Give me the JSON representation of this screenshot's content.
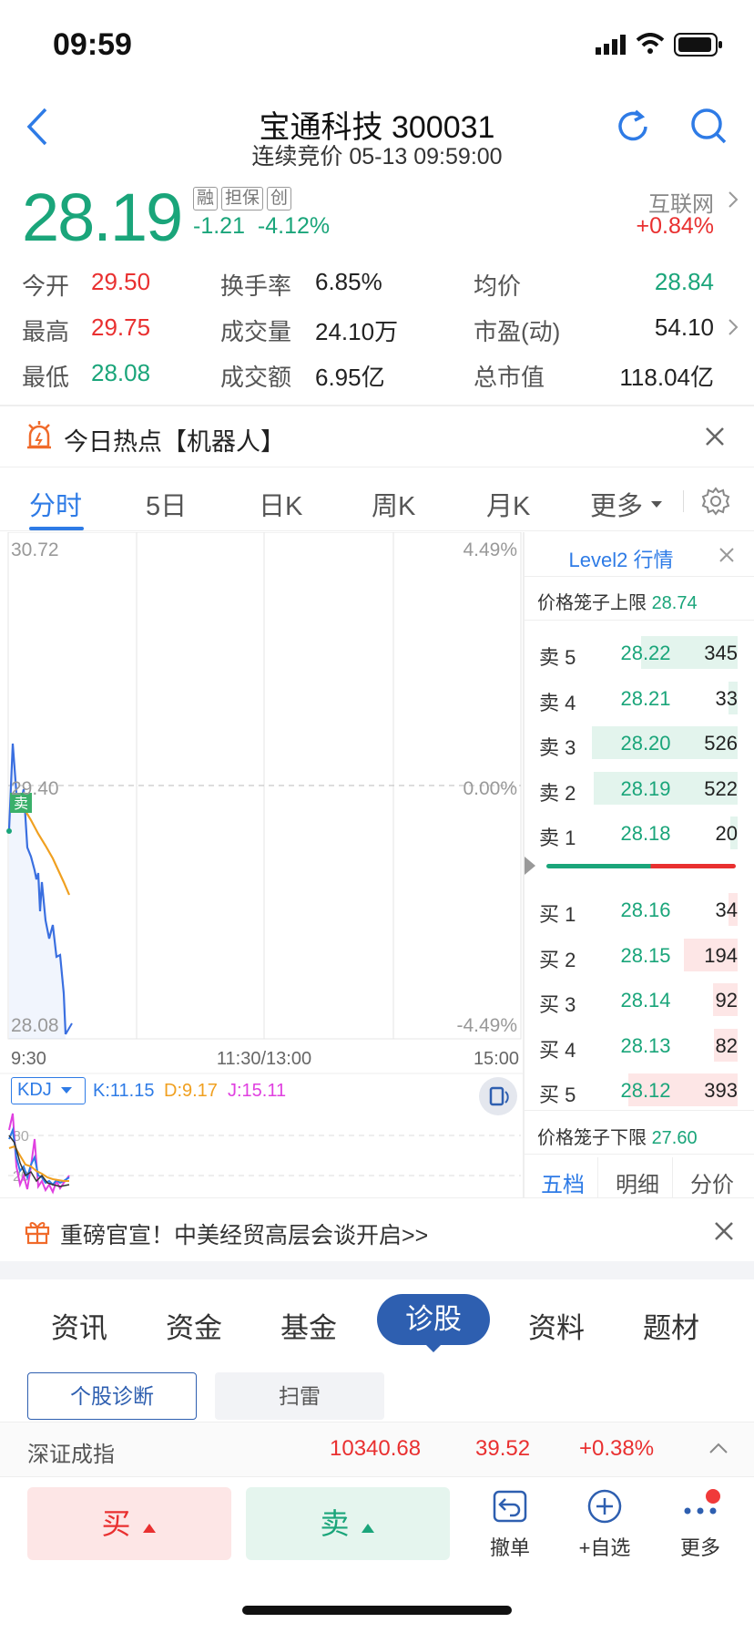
{
  "status_bar": {
    "time": "09:59"
  },
  "header": {
    "title": "宝通科技 300031",
    "subtitle": "连续竞价 05-13 09:59:00"
  },
  "quote": {
    "price": "28.19",
    "tags": [
      "融",
      "担保",
      "创"
    ],
    "change": "-1.21",
    "change_pct": "-4.12%",
    "sector_name": "互联网",
    "sector_change": "+0.84%"
  },
  "stats": [
    {
      "label": "今开",
      "value": "29.50"
    },
    {
      "label": "换手率",
      "value": "6.85%"
    },
    {
      "label": "均价",
      "value": "28.84"
    },
    {
      "label": "最高",
      "value": "29.75"
    },
    {
      "label": "成交量",
      "value": "24.10万"
    },
    {
      "label": "市盈(动)",
      "value": "54.10"
    },
    {
      "label": "最低",
      "value": "28.08"
    },
    {
      "label": "成交额",
      "value": "6.95亿"
    },
    {
      "label": "总市值",
      "value": "118.04亿"
    }
  ],
  "hot_banner": {
    "text": "今日热点【机器人】"
  },
  "chart_tabs": [
    "分时",
    "5日",
    "日K",
    "周K",
    "月K",
    "更多"
  ],
  "chart": {
    "y_top": "30.72",
    "y_mid": "29.40",
    "y_bottom": "28.08",
    "pct_top": "4.49%",
    "pct_mid": "0.00%",
    "pct_bottom": "-4.49%",
    "x_start": "9:30",
    "x_mid": "11:30/13:00",
    "x_end": "15:00",
    "sell_marker": "卖"
  },
  "kdj": {
    "name": "KDJ",
    "k": "K:11.15",
    "d": "D:9.17",
    "j": "J:15.11",
    "level_80": "80",
    "level_20": "20"
  },
  "level2": {
    "title": "Level2 行情",
    "upper_limit_label": "价格笼子上限",
    "upper_limit": "28.74",
    "lower_limit_label": "价格笼子下限",
    "lower_limit": "27.60",
    "asks": [
      {
        "label": "卖 5",
        "price": "28.22",
        "vol": "345",
        "share": 0.66
      },
      {
        "label": "卖 4",
        "price": "28.21",
        "vol": "33",
        "share": 0.06
      },
      {
        "label": "卖 3",
        "price": "28.20",
        "vol": "526",
        "share": 1.0
      },
      {
        "label": "卖 2",
        "price": "28.19",
        "vol": "522",
        "share": 0.99
      },
      {
        "label": "卖 1",
        "price": "28.18",
        "vol": "20",
        "share": 0.04
      }
    ],
    "bids": [
      {
        "label": "买 1",
        "price": "28.16",
        "vol": "34",
        "share": 0.06
      },
      {
        "label": "买 2",
        "price": "28.15",
        "vol": "194",
        "share": 0.37
      },
      {
        "label": "买 3",
        "price": "28.14",
        "vol": "92",
        "share": 0.17
      },
      {
        "label": "买 4",
        "price": "28.13",
        "vol": "82",
        "share": 0.16
      },
      {
        "label": "买 5",
        "price": "28.12",
        "vol": "393",
        "share": 0.75
      }
    ],
    "tabs": [
      "五档",
      "明细",
      "分价"
    ]
  },
  "news_banner": {
    "text": "重磅官宣！中美经贸高层会谈开启>>"
  },
  "section_tabs": [
    "资讯",
    "资金",
    "基金",
    "诊股",
    "资料",
    "题材"
  ],
  "sub_tabs": [
    "个股诊断",
    "扫雷"
  ],
  "index_bar": {
    "name": "深证成指",
    "value": "10340.68",
    "change": "39.52",
    "change_pct": "+0.38%"
  },
  "actions": {
    "buy": "买",
    "sell": "卖",
    "cancel": "撤单",
    "watch": "+自选",
    "more": "更多"
  },
  "colors": {
    "up": "#e93030",
    "down": "#1aa57a",
    "accent": "#2e7be6",
    "avg_line": "#f0a020",
    "price_line": "#3a6fe0"
  }
}
